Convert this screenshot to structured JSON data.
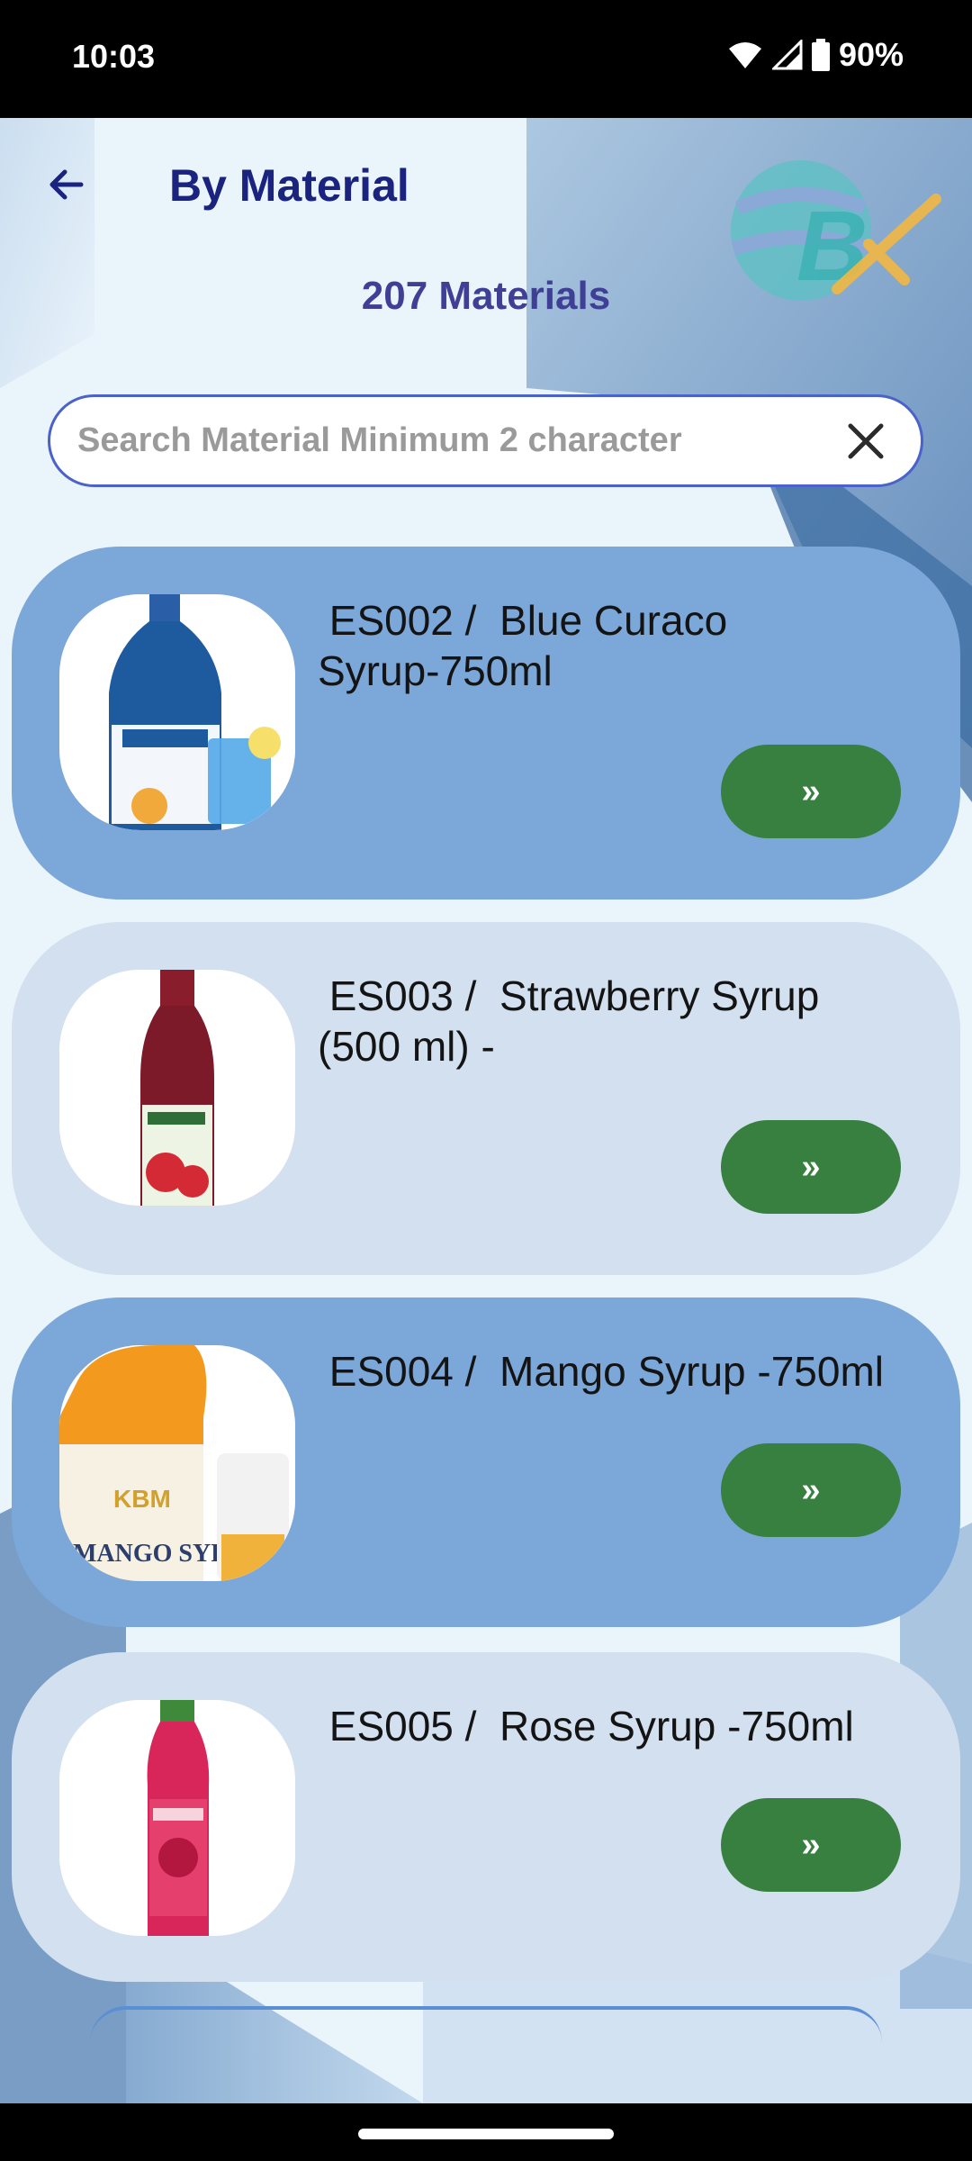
{
  "status_bar": {
    "time": "10:03",
    "battery": "90%",
    "icons": [
      "wifi-icon",
      "signal-icon",
      "battery-icon"
    ]
  },
  "header": {
    "title": "By Material",
    "back_icon": "arrow-left-icon",
    "logo_icon": "globe-bx-logo"
  },
  "count_text": "207 Materials",
  "search": {
    "placeholder": "Search Material Minimum 2 character",
    "value": "",
    "clear_icon": "close-icon"
  },
  "materials": [
    {
      "title": " ES002 /  Blue Curaco\nSyrup-750ml",
      "button": "»",
      "style": "dark"
    },
    {
      "title": " ES003 /  Strawberry Syrup\n(500 ml) -",
      "button": "»",
      "style": "light"
    },
    {
      "title": " ES004 /  Mango Syrup -750ml",
      "button": "»",
      "style": "dark"
    },
    {
      "title": " ES005 /  Rose Syrup -750ml",
      "button": "»",
      "style": "light"
    }
  ],
  "colors": {
    "title": "#1a237e",
    "count": "#3f3f96",
    "card_dark": "#7ba7d9",
    "card_light": "#d3e0f0",
    "button": "#37803f",
    "search_border": "#4a62c9"
  }
}
